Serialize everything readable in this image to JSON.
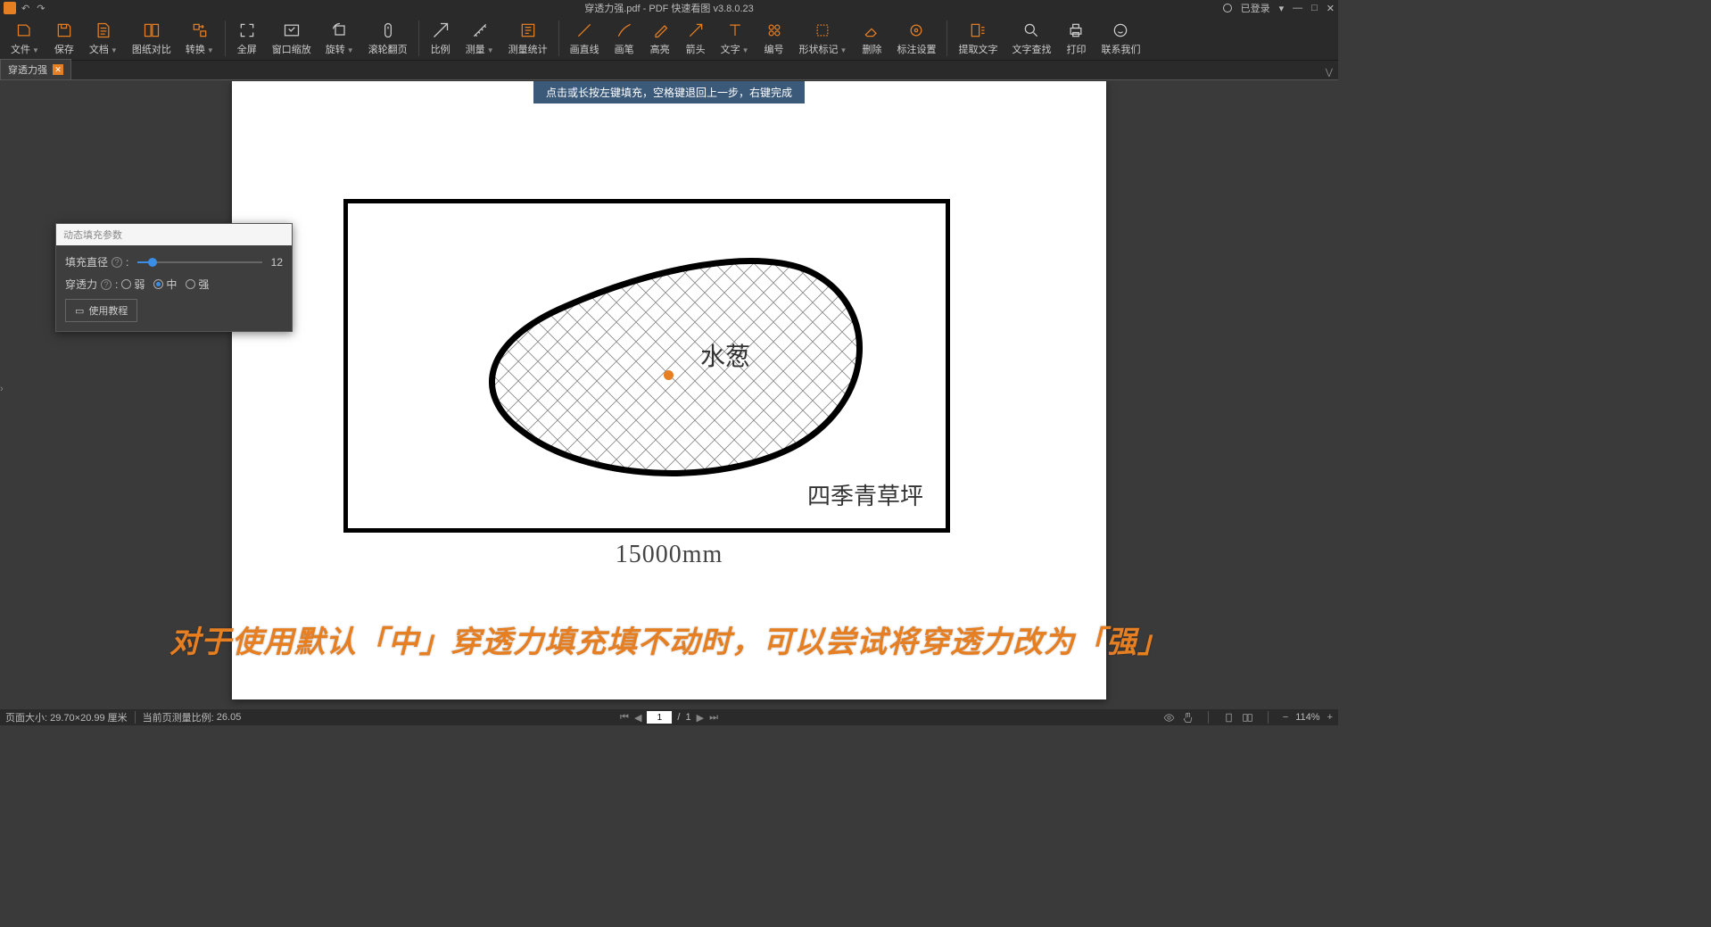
{
  "titlebar": {
    "filename": "穿透力强.pdf",
    "app_name": "PDF 快速看图",
    "version": "v3.8.0.23",
    "login": "已登录"
  },
  "toolbar": {
    "file": "文件",
    "save": "保存",
    "document": "文档",
    "compare": "图纸对比",
    "convert": "转换",
    "fullscreen": "全屏",
    "window_zoom": "窗口缩放",
    "rotate": "旋转",
    "scroll_flip": "滚轮翻页",
    "scale": "比例",
    "measure": "测量",
    "measure_stat": "测量统计",
    "line": "画直线",
    "pen": "画笔",
    "highlight": "高亮",
    "arrow": "箭头",
    "text": "文字",
    "number": "编号",
    "shape_mark": "形状标记",
    "erase": "删除",
    "annot_settings": "标注设置",
    "extract_text": "提取文字",
    "find_text": "文字查找",
    "print": "打印",
    "contact": "联系我们"
  },
  "tab": {
    "name": "穿透力强"
  },
  "hint": "点击或长按左键填充，空格键退回上一步，右键完成",
  "drawing": {
    "dimension": "15000mm",
    "lawn": "四季青草坪",
    "pond": "水葱"
  },
  "panel": {
    "title": "动态填充参数",
    "diameter_label": "填充直径",
    "diameter_value": "12",
    "penetration_label": "穿透力",
    "opt_weak": "弱",
    "opt_mid": "中",
    "opt_strong": "强",
    "tutorial": "使用教程"
  },
  "caption": "对于使用默认「中」穿透力填充填不动时，可以尝试将穿透力改为「强」",
  "status": {
    "page_size_label": "页面大小:",
    "page_size_value": "29.70×20.99 厘米",
    "scale_label": "当前页测量比例:",
    "scale_value": "26.05",
    "current_page": "1",
    "total_pages": "1",
    "zoom": "114%"
  }
}
